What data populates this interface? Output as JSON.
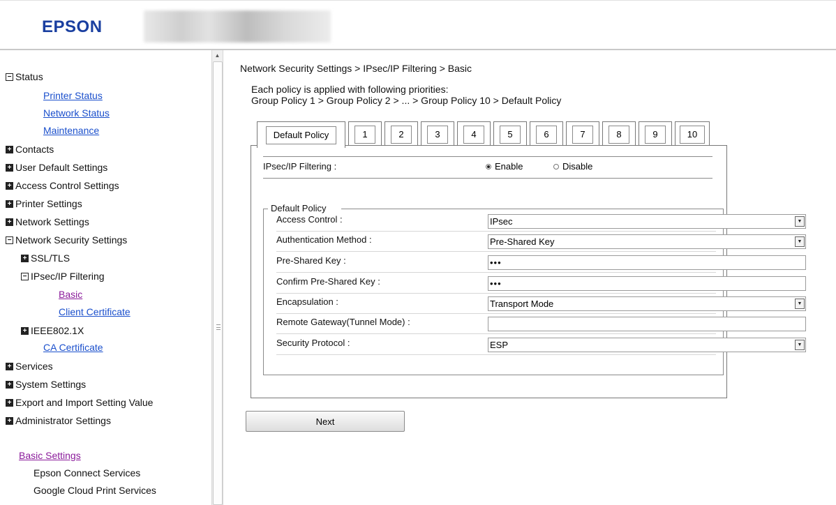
{
  "header": {
    "logo": "EPSON"
  },
  "sidebar": {
    "status": "Status",
    "printer_status": "Printer Status",
    "network_status": "Network Status",
    "maintenance": "Maintenance",
    "contacts": "Contacts",
    "user_default_settings": "User Default Settings",
    "access_control_settings": "Access Control Settings",
    "printer_settings": "Printer Settings",
    "network_settings": "Network Settings",
    "network_security_settings": "Network Security Settings",
    "ssl_tls": "SSL/TLS",
    "ipsec_filtering": "IPsec/IP Filtering",
    "basic": "Basic",
    "client_certificate": "Client Certificate",
    "ieee8021x": "IEEE802.1X",
    "ca_certificate": "CA Certificate",
    "services": "Services",
    "system_settings": "System Settings",
    "export_import": "Export and Import Setting Value",
    "administrator_settings": "Administrator Settings",
    "basic_settings": "Basic Settings",
    "epson_connect": "Epson Connect Services",
    "google_cloud_print": "Google Cloud Print Services"
  },
  "main": {
    "breadcrumb": "Network Security Settings > IPsec/IP Filtering > Basic",
    "intro_line1": "Each policy is applied with following priorities:",
    "intro_line2": "Group Policy 1 > Group Policy 2 > ... > Group Policy 10 > Default Policy",
    "tabs": [
      "Default Policy",
      "1",
      "2",
      "3",
      "4",
      "5",
      "6",
      "7",
      "8",
      "9",
      "10"
    ],
    "ipsec_filtering_label": "IPsec/IP Filtering :",
    "enable_label": "Enable",
    "disable_label": "Disable",
    "ipsec_enabled": true,
    "fieldset_legend": "Default Policy",
    "fields": {
      "access_control_label": "Access Control :",
      "access_control_value": "IPsec",
      "auth_method_label": "Authentication Method :",
      "auth_method_value": "Pre-Shared Key",
      "psk_label": "Pre-Shared Key :",
      "psk_value": "•••",
      "confirm_psk_label": "Confirm Pre-Shared Key :",
      "confirm_psk_value": "•••",
      "encapsulation_label": "Encapsulation :",
      "encapsulation_value": "Transport Mode",
      "remote_gateway_label": "Remote Gateway(Tunnel Mode) :",
      "remote_gateway_value": "",
      "security_protocol_label": "Security Protocol :",
      "security_protocol_value": "ESP"
    },
    "next_label": "Next"
  },
  "colors": {
    "logo": "#1a3fa0",
    "link": "#1a4fcc",
    "visited_link": "#8a1a9a"
  },
  "icons": {
    "collapse": "minus-box-icon",
    "expand": "plus-box-icon",
    "dropdown": "dropdown-arrow-icon"
  }
}
